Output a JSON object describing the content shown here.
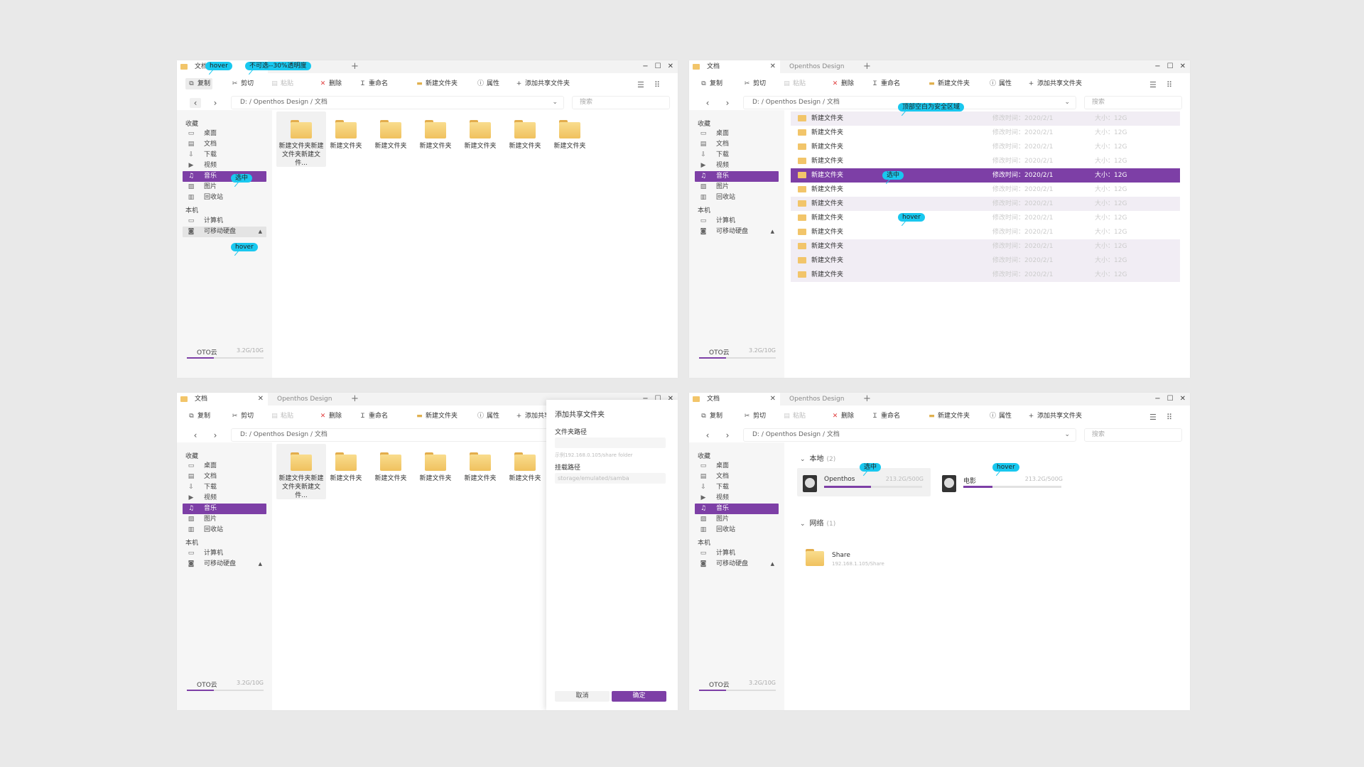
{
  "tabs": {
    "active": "文档",
    "second": "Openthos Design",
    "close": "✕",
    "add": "+"
  },
  "window_controls": {
    "minimize": "−",
    "maximize": "☐",
    "close": "✕"
  },
  "toolbar": {
    "copy": "复制",
    "cut": "剪切",
    "paste": "粘贴",
    "delete": "删除",
    "rename": "重命名",
    "new_folder": "新建文件夹",
    "properties": "属性",
    "add_share": "添加共享文件夹"
  },
  "nav": {
    "back": "‹",
    "forward": "›",
    "path": "D: / Openthos Design / 文档",
    "search_placeholder": "搜索"
  },
  "sidebar": {
    "favorites_title": "收藏",
    "favorites": [
      "桌面",
      "文档",
      "下载",
      "视频",
      "音乐",
      "图片",
      "回收站"
    ],
    "local_title": "本机",
    "local": [
      "计算机",
      "可移动硬盘"
    ],
    "eject": "▲",
    "cloud_label": "OTO云",
    "cloud_size": "3.2G/10G",
    "cloud_used_fraction": 0.35
  },
  "grid_items": {
    "first": "新建文件夹新建文件夹新建文件...",
    "rest": [
      "新建文件夹",
      "新建文件夹",
      "新建文件夹",
      "新建文件夹",
      "新建文件夹",
      "新建文件夹"
    ]
  },
  "list_items": [
    {
      "name": "新建文件夹",
      "date": "修改时间：2020/2/1",
      "size": "大小：12G"
    },
    {
      "name": "新建文件夹",
      "date": "修改时间：2020/2/1",
      "size": "大小：12G"
    },
    {
      "name": "新建文件夹",
      "date": "修改时间：2020/2/1",
      "size": "大小：12G"
    },
    {
      "name": "新建文件夹",
      "date": "修改时间：2020/2/1",
      "size": "大小：12G"
    },
    {
      "name": "新建文件夹",
      "date": "修改时间：2020/2/1",
      "size": "大小：12G"
    },
    {
      "name": "新建文件夹",
      "date": "修改时间：2020/2/1",
      "size": "大小：12G"
    },
    {
      "name": "新建文件夹",
      "date": "修改时间：2020/2/1",
      "size": "大小：12G"
    },
    {
      "name": "新建文件夹",
      "date": "修改时间：2020/2/1",
      "size": "大小：12G"
    },
    {
      "name": "新建文件夹",
      "date": "修改时间：2020/2/1",
      "size": "大小：12G"
    },
    {
      "name": "新建文件夹",
      "date": "修改时间：2020/2/1",
      "size": "大小：12G"
    },
    {
      "name": "新建文件夹",
      "date": "修改时间：2020/2/1",
      "size": "大小：12G"
    },
    {
      "name": "新建文件夹",
      "date": "修改时间：2020/2/1",
      "size": "大小：12G"
    }
  ],
  "dialog": {
    "title": "添加共享文件夹",
    "folder_path_label": "文件夹路径",
    "folder_path_hint": "示例192.168.0.105/share folder",
    "mount_label": "挂载路径",
    "mount_value": "storage/emulated/samba",
    "cancel": "取消",
    "ok": "确定"
  },
  "computer_view": {
    "local_group": "本地",
    "local_count": "(2)",
    "network_group": "网络",
    "network_count": "(1)",
    "disks": [
      {
        "name": "Openthos",
        "size": "213.2G/500G",
        "used_fraction": 0.48
      },
      {
        "name": "电影",
        "size": "213.2G/500G",
        "used_fraction": 0.3
      }
    ],
    "share": {
      "name": "Share",
      "path": "192.168.1.105/Share"
    }
  },
  "annotations": {
    "hover": "hover",
    "disabled_note": "不可选--30%透明度",
    "selected": "选中",
    "top_safe_area": "顶部空白为安全区域"
  },
  "colors": {
    "accent": "#7d3fa6",
    "annotation": "#19c8ef",
    "folder": "#f2c56a"
  }
}
